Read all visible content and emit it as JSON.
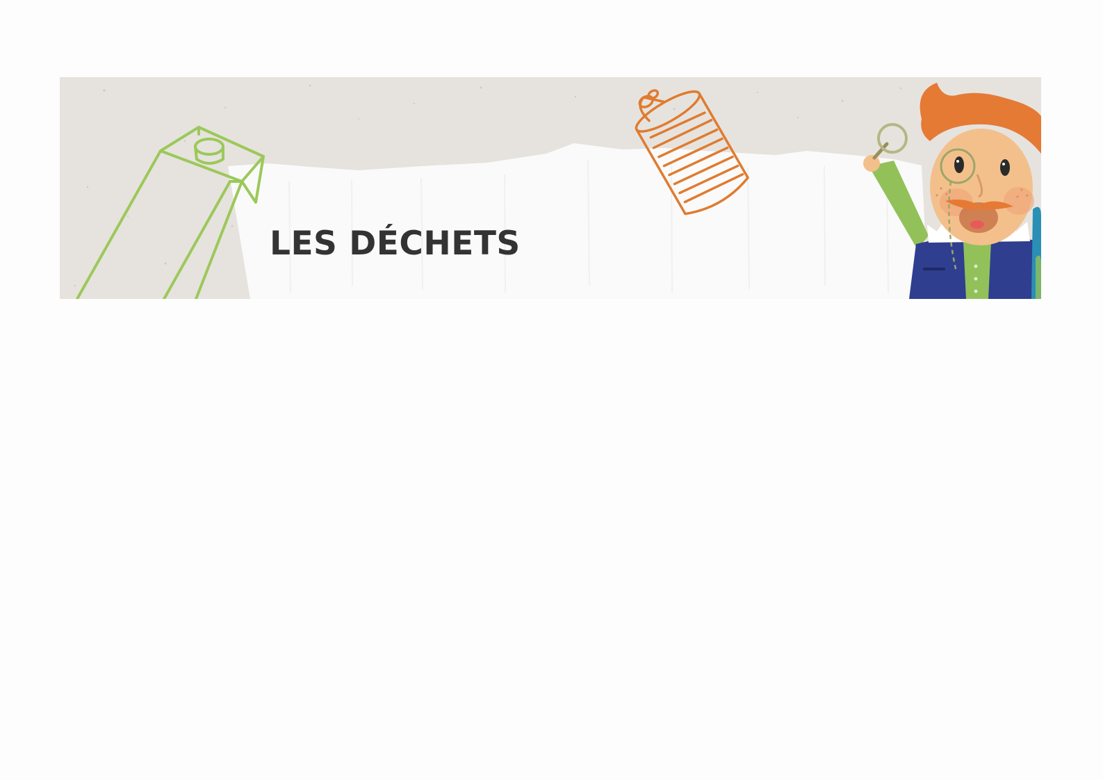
{
  "document": {
    "title": "LES DÉCHETS"
  },
  "illustrations": {
    "carton_icon": "milk-carton-icon",
    "can_icon": "tin-can-icon",
    "character_icon": "mascot-with-monocle-icon"
  },
  "colors": {
    "paper_background": "#e6e3de",
    "torn_paper": "#fafafa",
    "title_text": "#333333",
    "carton_stroke": "#9cc85a",
    "can_stroke": "#e07b2f",
    "hair": "#e57a35",
    "vest": "#2f3e8f",
    "sleeve": "#92c15a",
    "skin": "#f3c08c"
  }
}
